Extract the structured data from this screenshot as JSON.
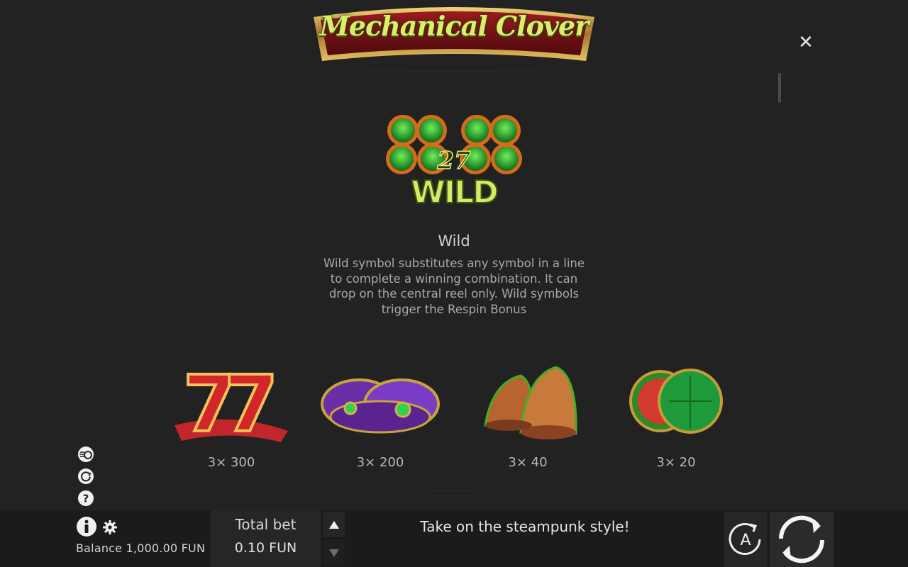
{
  "game": {
    "title": "Mechanical Clover"
  },
  "paytable": {
    "wild": {
      "icon_label": "27 WILD",
      "title": "Wild",
      "description": "Wild symbol substitutes any symbol in a line to complete a winning combination. It can drop on the central reel only. Wild symbols trigger the Respin Bonus"
    },
    "symbols": [
      {
        "icon": "sevens-icon",
        "payout": "3× 300"
      },
      {
        "icon": "top-hats-icon",
        "payout": "3× 200"
      },
      {
        "icon": "bells-icon",
        "payout": "3× 40"
      },
      {
        "icon": "watermelons-icon",
        "payout": "3× 20"
      }
    ]
  },
  "side_icons": [
    "turbo-icon",
    "replay-icon",
    "help-icon"
  ],
  "bottom_bar": {
    "balance": "Balance 1,000.00 FUN",
    "total_bet_label": "Total bet",
    "total_bet_value": "0.10 FUN",
    "message": "Take on the steampunk style!",
    "autoplay_label": "A"
  },
  "colors": {
    "background": "#222223",
    "bar": "#1b1b1c",
    "title_text": "#d9ef6a",
    "banner_red": "#7a1418",
    "banner_gold": "#c9a24a"
  }
}
